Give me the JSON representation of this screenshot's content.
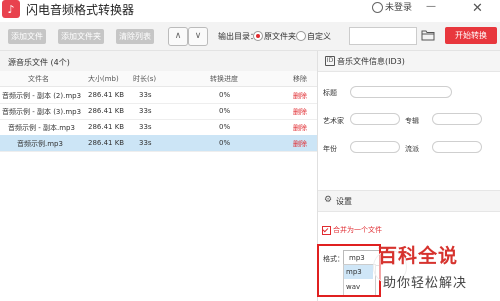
{
  "app": {
    "title": "闪电音频格式转换器",
    "login": "未登录",
    "logo_icon": "music-note-icon"
  },
  "toolbar": {
    "add_file": "添加文件",
    "add_folder": "添加文件夹",
    "clear_list": "清除列表",
    "move_up": "∧",
    "move_down": "∨",
    "output_dir_label": "输出目录：",
    "option_source": "原文件夹",
    "option_custom": "自定义",
    "path_value": "",
    "start_button": "开始转换"
  },
  "file_list": {
    "title": "源音乐文件 (4个)",
    "columns": [
      "文件名",
      "大小(mb)",
      "时长(s)",
      "转换进度",
      "移除"
    ],
    "rows": [
      {
        "name": "音频示例 - 副本 (2).mp3",
        "size": "286.41 KB",
        "duration": "33s",
        "progress": "0%",
        "remove": "删除"
      },
      {
        "name": "音频示例 - 副本 (3).mp3",
        "size": "286.41 KB",
        "duration": "33s",
        "progress": "0%",
        "remove": "删除"
      },
      {
        "name": "音频示例 - 副本.mp3",
        "size": "286.41 KB",
        "duration": "33s",
        "progress": "0%",
        "remove": "删除"
      },
      {
        "name": "音频示例.mp3",
        "size": "286.41 KB",
        "duration": "33s",
        "progress": "0%",
        "remove": "删除"
      }
    ],
    "selected_row": 3
  },
  "id3": {
    "title": "音乐文件信息(ID3)",
    "title_label": "标题",
    "artist_label": "艺术家",
    "album_label": "专辑",
    "year_label": "年份",
    "genre_label": "流派"
  },
  "settings": {
    "title": "设置",
    "merge_label": "合并为一个文件",
    "merge_checked": true,
    "format_label": "格式：",
    "format_value": "mp3",
    "format_options": [
      "mp3",
      "wav"
    ],
    "highlighted_option": "mp3"
  },
  "watermark": {
    "line1": "百科全说",
    "line2": "助你轻松解决"
  },
  "colors": {
    "accent": "#e8373d",
    "selection": "#cce5f6",
    "highlight_border": "#e02020"
  }
}
